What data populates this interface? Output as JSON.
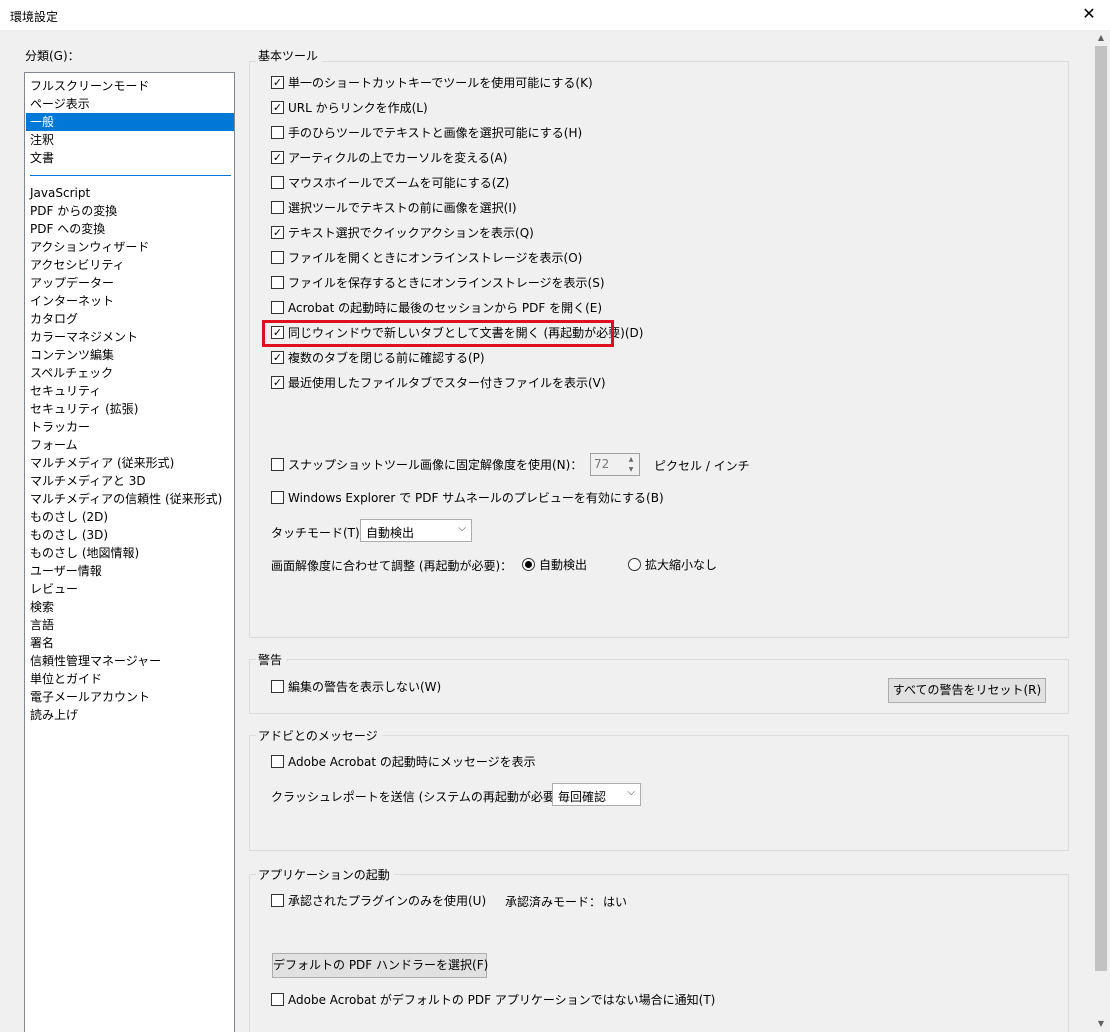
{
  "window": {
    "title": "環境設定",
    "close_glyph": "✕"
  },
  "categories": {
    "label": "分類(G)：",
    "top_items": [
      "フルスクリーンモード",
      "ページ表示",
      "一般",
      "注釈",
      "文書"
    ],
    "selected": "一般",
    "items": [
      "JavaScript",
      "PDF からの変換",
      "PDF への変換",
      "アクションウィザード",
      "アクセシビリティ",
      "アップデーター",
      "インターネット",
      "カタログ",
      "カラーマネジメント",
      "コンテンツ編集",
      "スペルチェック",
      "セキュリティ",
      "セキュリティ (拡張)",
      "トラッカー",
      "フォーム",
      "マルチメディア (従来形式)",
      "マルチメディアと 3D",
      "マルチメディアの信頼性 (従来形式)",
      "ものさし (2D)",
      "ものさし (3D)",
      "ものさし (地図情報)",
      "ユーザー情報",
      "レビュー",
      "検索",
      "言語",
      "署名",
      "信頼性管理マネージャー",
      "単位とガイド",
      "電子メールアカウント",
      "読み上げ"
    ]
  },
  "basic_tools": {
    "title": "基本ツール",
    "options": [
      {
        "label": "単一のショートカットキーでツールを使用可能にする(K)",
        "checked": true
      },
      {
        "label": "URL からリンクを作成(L)",
        "checked": true
      },
      {
        "label": "手のひらツールでテキストと画像を選択可能にする(H)",
        "checked": false
      },
      {
        "label": "アーティクルの上でカーソルを変える(A)",
        "checked": true
      },
      {
        "label": "マウスホイールでズームを可能にする(Z)",
        "checked": false
      },
      {
        "label": "選択ツールでテキストの前に画像を選択(I)",
        "checked": false
      },
      {
        "label": "テキスト選択でクイックアクションを表示(Q)",
        "checked": true
      },
      {
        "label": "ファイルを開くときにオンラインストレージを表示(O)",
        "checked": false
      },
      {
        "label": "ファイルを保存するときにオンラインストレージを表示(S)",
        "checked": false
      },
      {
        "label": "Acrobat の起動時に最後のセッションから PDF を開く(E)",
        "checked": false
      },
      {
        "label": "同じウィンドウで新しいタブとして文書を開く (再起動が必要)(D)",
        "checked": true
      },
      {
        "label": "複数のタブを閉じる前に確認する(P)",
        "checked": true
      },
      {
        "label": "最近使用したファイルタブでスター付きファイルを表示(V)",
        "checked": true
      }
    ],
    "snapshot": {
      "label": "スナップショットツール画像に固定解像度を使用(N)：",
      "checked": false,
      "value": "72",
      "unit": "ピクセル / インチ"
    },
    "thumbnail": {
      "label": "Windows Explorer で PDF サムネールのプレビューを有効にする(B)",
      "checked": false
    },
    "touch_mode": {
      "label": "タッチモード(T)：",
      "value": "自動検出"
    },
    "scaling": {
      "label": "画面解像度に合わせて調整 (再起動が必要)：",
      "options": [
        {
          "label": "自動検出",
          "selected": true
        },
        {
          "label": "拡大縮小なし",
          "selected": false
        }
      ]
    }
  },
  "warnings": {
    "title": "警告",
    "option": {
      "label": "編集の警告を表示しない(W)",
      "checked": false
    },
    "reset_button": "すべての警告をリセット(R)"
  },
  "adobe_messages": {
    "title": "アドビとのメッセージ",
    "option": {
      "label": "Adobe Acrobat の起動時にメッセージを表示",
      "checked": false
    },
    "crash_report": {
      "label": "クラッシュレポートを送信 (システムの再起動が必要)：",
      "value": "毎回確認"
    }
  },
  "app_startup": {
    "title": "アプリケーションの起動",
    "plugins": {
      "label": "承認されたプラグインのみを使用(U)",
      "checked": false
    },
    "approved_mode": {
      "label": "承認済みモード：",
      "value": "はい"
    },
    "handler_button": "デフォルトの PDF ハンドラーを選択(F)",
    "notify": {
      "label": "Adobe Acrobat がデフォルトの PDF アプリケーションではない場合に通知(T)",
      "checked": false
    }
  },
  "check_glyph": "✓"
}
